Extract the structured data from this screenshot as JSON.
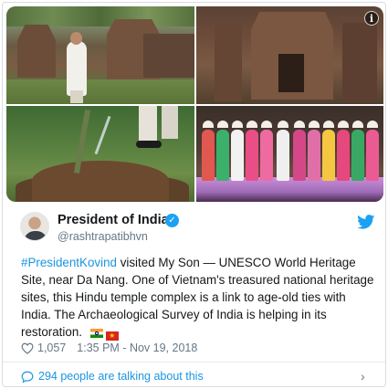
{
  "tweet": {
    "author_name": "President of India",
    "handle": "@rashtrapatibhvn",
    "hashtag": "#PresidentKovind",
    "text": " visited My Son — UNESCO World Heritage Site, near Da Nang. One of Vietnam's treasured national heritage sites, this Hindu temple complex is a link to age-old ties with India. The Archaeological Survey of India is helping in its restoration.",
    "flags": [
      "flag-india-icon",
      "flag-vietnam-icon"
    ],
    "likes": "1,057",
    "timestamp": "1:35 PM - Nov 19, 2018",
    "talking_text": "294 people are talking about this"
  },
  "media": {
    "info_glyph": "i",
    "photos": [
      "temple-ruins-photo",
      "temple-facade-photo",
      "tree-planting-photo",
      "performers-photo"
    ]
  },
  "icons": {
    "verified": "verified-badge-icon",
    "brand": "twitter-bird-icon",
    "like": "heart-icon",
    "reply": "speech-bubble-icon",
    "more": "chevron-right-icon"
  },
  "colors": {
    "accent": "#1da1f2",
    "link": "#1b95e0",
    "muted": "#657786",
    "text": "#14171a"
  }
}
